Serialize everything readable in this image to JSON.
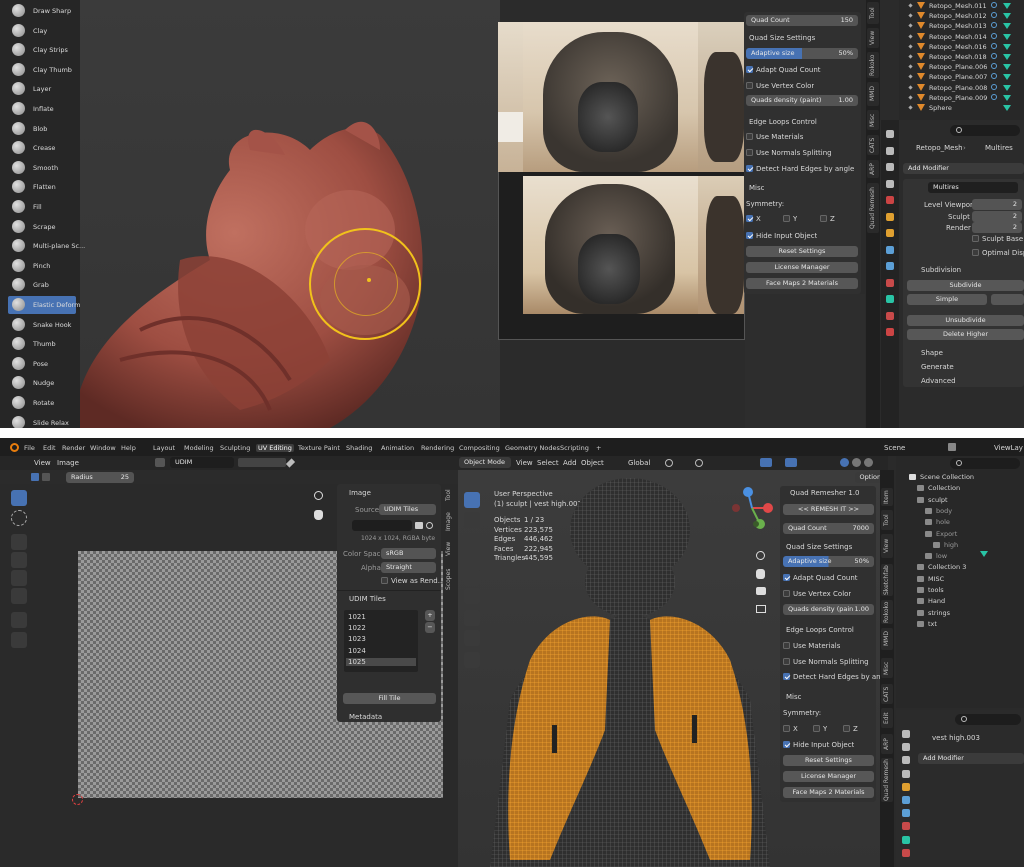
{
  "top": {
    "brushes": [
      "Draw Sharp",
      "Clay",
      "Clay Strips",
      "Clay Thumb",
      "Layer",
      "Inflate",
      "Blob",
      "Crease",
      "Smooth",
      "Flatten",
      "Fill",
      "Scrape",
      "Multi-plane Sc...",
      "Pinch",
      "Grab",
      "Elastic Deform",
      "Snake Hook",
      "Thumb",
      "Pose",
      "Nudge",
      "Rotate",
      "Slide Relax"
    ],
    "active_brush": "Elastic Deform",
    "quad": {
      "quad_count_label": "Quad Count",
      "quad_count_value": "150",
      "size_settings": "Quad Size Settings",
      "adaptive_label": "Adaptive size",
      "adaptive_value": "50%",
      "adapt_quad_count": "Adapt Quad Count",
      "use_vertex_color": "Use Vertex Color",
      "density_label": "Quads density (paint)",
      "density_value": "1.00",
      "edge_loops": "Edge Loops Control",
      "use_materials": "Use Materials",
      "use_normals": "Use Normals Splitting",
      "detect_edges": "Detect Hard Edges by angle",
      "misc": "Misc",
      "symmetry": "Symmetry:",
      "x": "X",
      "y": "Y",
      "z": "Z",
      "hide_input": "Hide Input Object",
      "reset": "Reset Settings",
      "license": "License Manager",
      "facemaps": "Face Maps 2 Materials"
    },
    "vtabs": [
      "Tool",
      "View",
      "Rokoko",
      "MMD",
      "Misc",
      "CATS",
      "ARP",
      "Quad Remesh"
    ],
    "outliner": [
      {
        "name": "Retopo_Mesh.011"
      },
      {
        "name": "Retopo_Mesh.012"
      },
      {
        "name": "Retopo_Mesh.013"
      },
      {
        "name": "Retopo_Mesh.014"
      },
      {
        "name": "Retopo_Mesh.016"
      },
      {
        "name": "Retopo_Mesh.018"
      },
      {
        "name": "Retopo_Plane.006"
      },
      {
        "name": "Retopo_Plane.007"
      },
      {
        "name": "Retopo_Plane.008"
      },
      {
        "name": "Retopo_Plane.009"
      },
      {
        "name": "Sphere"
      }
    ],
    "props": {
      "breadcrumb_obj": "Retopo_Mesh",
      "breadcrumb_mod": "Multires",
      "add_modifier": "Add Modifier",
      "modifier_name": "Multires",
      "level_viewport": "Level Viewport",
      "sculpt": "Sculpt",
      "render": "Render",
      "level_values": [
        "2",
        "2",
        "2"
      ],
      "sculpt_base": "Sculpt Base M",
      "optimal": "Optimal Displ",
      "subdivision": "Subdivision",
      "subdivide": "Subdivide",
      "simple": "Simple",
      "unsubdivide": "Unsubdivide",
      "delete_higher": "Delete Higher",
      "shape": "Shape",
      "generate": "Generate",
      "advanced": "Advanced"
    }
  },
  "bottom": {
    "menus": [
      "File",
      "Edit",
      "Render",
      "Window",
      "Help"
    ],
    "workspaces": [
      "Layout",
      "Modeling",
      "Sculpting",
      "UV Editing",
      "Texture Paint",
      "Shading",
      "Animation",
      "Rendering",
      "Compositing",
      "Geometry Nodes",
      "Scripting"
    ],
    "active_workspace": "UV Editing",
    "scene": "Scene",
    "view_layer": "ViewLay",
    "uv": {
      "view": "View",
      "image": "Image",
      "image_name": "UDIM",
      "radius_label": "Radius",
      "radius_value": "25",
      "panel_image": "Image",
      "source_label": "Source",
      "source_value": "UDIM Tiles",
      "size_info": "1024 x 1024, RGBA byte",
      "color_space_label": "Color Space",
      "color_space_value": "sRGB",
      "alpha_label": "Alpha",
      "alpha_value": "Straight",
      "view_as_render": "View as Rend...",
      "udim_tiles": "UDIM Tiles",
      "tiles": [
        "1021",
        "1022",
        "1023",
        "1024",
        "1025"
      ],
      "fill_tile": "Fill Tile",
      "metadata": "Metadata",
      "vtabs": [
        "Tool",
        "Image",
        "View",
        "Scopes"
      ]
    },
    "viewport": {
      "mode": "Object Mode",
      "view": "View",
      "select": "Select",
      "add": "Add",
      "object": "Object",
      "transform": "Global",
      "options": "Options",
      "perspective": "User Perspective",
      "collection": "(1) sculpt | vest high.003",
      "stats": [
        {
          "label": "Objects",
          "value": "1 / 23"
        },
        {
          "label": "Vertices",
          "value": "223,575"
        },
        {
          "label": "Edges",
          "value": "446,462"
        },
        {
          "label": "Faces",
          "value": "222,945"
        },
        {
          "label": "Triangles",
          "value": "445,595"
        }
      ]
    },
    "quad": {
      "title": "Quad Remesher 1.0",
      "remesh": "<< REMESH IT >>",
      "quad_count_label": "Quad Count",
      "quad_count_value": "7000",
      "size_settings": "Quad Size Settings",
      "adaptive_label": "Adaptive size",
      "adaptive_value": "50%",
      "adapt_quad_count": "Adapt Quad Count",
      "use_vertex_color": "Use Vertex Color",
      "density_label": "Quads density (pain",
      "density_value": "1.00",
      "edge_loops": "Edge Loops Control",
      "use_materials": "Use Materials",
      "use_normals": "Use Normals Splitting",
      "detect_edges": "Detect Hard Edges by angle",
      "misc": "Misc",
      "symmetry": "Symmetry:",
      "x": "X",
      "y": "Y",
      "z": "Z",
      "hide_input": "Hide Input Object",
      "reset": "Reset Settings",
      "license": "License Manager",
      "facemaps": "Face Maps 2 Materials"
    },
    "vtabs": [
      "Item",
      "Tool",
      "View",
      "Sketchfab",
      "Rokoko",
      "MMD",
      "Misc",
      "CATS",
      "Edit",
      "ARP",
      "Quad Remesh"
    ],
    "outliner": [
      {
        "name": "Scene Collection",
        "indent": 0
      },
      {
        "name": "Collection",
        "indent": 1
      },
      {
        "name": "sculpt",
        "indent": 1
      },
      {
        "name": "body",
        "indent": 2
      },
      {
        "name": "hole",
        "indent": 2
      },
      {
        "name": "Export",
        "indent": 2
      },
      {
        "name": "high",
        "indent": 3
      },
      {
        "name": "low",
        "indent": 2
      },
      {
        "name": "Collection 3",
        "indent": 1
      },
      {
        "name": "MISC",
        "indent": 1
      },
      {
        "name": "tools",
        "indent": 1
      },
      {
        "name": "Hand",
        "indent": 1
      },
      {
        "name": "strings",
        "indent": 1
      },
      {
        "name": "txt",
        "indent": 1
      }
    ],
    "props": {
      "object": "vest high.003",
      "add_modifier": "Add Modifier"
    }
  }
}
